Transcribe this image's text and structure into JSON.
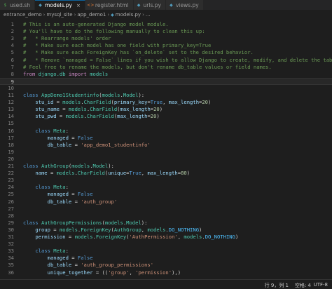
{
  "tabs": [
    {
      "label": "used.sh",
      "icon": "terminal-file-icon",
      "glyph": "$",
      "color": "#4d9e4d",
      "active": false
    },
    {
      "label": "models.py",
      "icon": "python-file-icon",
      "glyph": "◆",
      "color": "#519aba",
      "active": true
    },
    {
      "label": "register.html",
      "icon": "html-file-icon",
      "glyph": "<>",
      "color": "#e37933",
      "active": false
    },
    {
      "label": "urls.py",
      "icon": "python-file-icon",
      "glyph": "◆",
      "color": "#519aba",
      "active": false
    },
    {
      "label": "views.py",
      "icon": "python-file-icon",
      "glyph": "◆",
      "color": "#519aba",
      "active": false
    }
  ],
  "breadcrumb": [
    "entrance_demo",
    "mysql_site",
    "app_demo1",
    "models.py",
    "..."
  ],
  "editor": {
    "current_line": 9,
    "lines": [
      {
        "n": "1",
        "t": [
          [
            "com",
            "# This is an auto-generated Django model module."
          ]
        ]
      },
      {
        "n": "2",
        "t": [
          [
            "com",
            "# You'll have to do the following manually to clean this up:"
          ]
        ]
      },
      {
        "n": "3",
        "t": [
          [
            "com",
            "#   * Rearrange models' order"
          ]
        ]
      },
      {
        "n": "4",
        "t": [
          [
            "com",
            "#   * Make sure each model has one field with primary_key=True"
          ]
        ]
      },
      {
        "n": "5",
        "t": [
          [
            "com",
            "#   * Make sure each ForeignKey has `on_delete` set to the desired behavior."
          ]
        ]
      },
      {
        "n": "6",
        "t": [
          [
            "com",
            "#   * Remove `managed = False` lines if you wish to allow Django to create, modify, and delete the table"
          ]
        ]
      },
      {
        "n": "7",
        "t": [
          [
            "com",
            "# Feel free to rename the models, but don't rename db_table values or field names."
          ]
        ]
      },
      {
        "n": "8",
        "t": [
          [
            "kw2",
            "from "
          ],
          [
            "cls",
            "django.db "
          ],
          [
            "kw2",
            "import "
          ],
          [
            "cls",
            "models"
          ]
        ]
      },
      {
        "n": "9",
        "t": []
      },
      {
        "n": "10",
        "t": []
      },
      {
        "n": "11",
        "t": [
          [
            "kw",
            "class "
          ],
          [
            "cls",
            "AppDemo1Studentinfo"
          ],
          [
            "plain",
            "("
          ],
          [
            "cls",
            "models"
          ],
          [
            "plain",
            "."
          ],
          [
            "cls",
            "Model"
          ],
          [
            "plain",
            "):"
          ]
        ]
      },
      {
        "n": "12",
        "t": [
          [
            "plain",
            "    "
          ],
          [
            "var",
            "stu_id"
          ],
          [
            "plain",
            " = "
          ],
          [
            "cls",
            "models"
          ],
          [
            "plain",
            "."
          ],
          [
            "cls",
            "CharField"
          ],
          [
            "plain",
            "("
          ],
          [
            "var",
            "primary_key"
          ],
          [
            "plain",
            "="
          ],
          [
            "const",
            "True"
          ],
          [
            "plain",
            ", "
          ],
          [
            "var",
            "max_length"
          ],
          [
            "plain",
            "="
          ],
          [
            "num",
            "20"
          ],
          [
            "plain",
            ")"
          ]
        ]
      },
      {
        "n": "13",
        "t": [
          [
            "plain",
            "    "
          ],
          [
            "var",
            "stu_name"
          ],
          [
            "plain",
            " = "
          ],
          [
            "cls",
            "models"
          ],
          [
            "plain",
            "."
          ],
          [
            "cls",
            "CharField"
          ],
          [
            "plain",
            "("
          ],
          [
            "var",
            "max_length"
          ],
          [
            "plain",
            "="
          ],
          [
            "num",
            "20"
          ],
          [
            "plain",
            ")"
          ]
        ]
      },
      {
        "n": "14",
        "t": [
          [
            "plain",
            "    "
          ],
          [
            "var",
            "stu_pwd"
          ],
          [
            "plain",
            " = "
          ],
          [
            "cls",
            "models"
          ],
          [
            "plain",
            "."
          ],
          [
            "cls",
            "CharField"
          ],
          [
            "plain",
            "("
          ],
          [
            "var",
            "max_length"
          ],
          [
            "plain",
            "="
          ],
          [
            "num",
            "20"
          ],
          [
            "plain",
            ")"
          ]
        ]
      },
      {
        "n": "15",
        "t": []
      },
      {
        "n": "16",
        "t": [
          [
            "plain",
            "    "
          ],
          [
            "kw",
            "class "
          ],
          [
            "cls",
            "Meta"
          ],
          [
            "plain",
            ":"
          ]
        ]
      },
      {
        "n": "17",
        "t": [
          [
            "plain",
            "        "
          ],
          [
            "var",
            "managed"
          ],
          [
            "plain",
            " = "
          ],
          [
            "const",
            "False"
          ]
        ]
      },
      {
        "n": "18",
        "t": [
          [
            "plain",
            "        "
          ],
          [
            "var",
            "db_table"
          ],
          [
            "plain",
            " = "
          ],
          [
            "str",
            "'app_demo1_studentinfo'"
          ]
        ]
      },
      {
        "n": "19",
        "t": []
      },
      {
        "n": "20",
        "t": []
      },
      {
        "n": "21",
        "t": [
          [
            "kw",
            "class "
          ],
          [
            "cls",
            "AuthGroup"
          ],
          [
            "plain",
            "("
          ],
          [
            "cls",
            "models"
          ],
          [
            "plain",
            "."
          ],
          [
            "cls",
            "Model"
          ],
          [
            "plain",
            "):"
          ]
        ]
      },
      {
        "n": "22",
        "t": [
          [
            "plain",
            "    "
          ],
          [
            "var",
            "name"
          ],
          [
            "plain",
            " = "
          ],
          [
            "cls",
            "models"
          ],
          [
            "plain",
            "."
          ],
          [
            "cls",
            "CharField"
          ],
          [
            "plain",
            "("
          ],
          [
            "var",
            "unique"
          ],
          [
            "plain",
            "="
          ],
          [
            "const",
            "True"
          ],
          [
            "plain",
            ", "
          ],
          [
            "var",
            "max_length"
          ],
          [
            "plain",
            "="
          ],
          [
            "num",
            "80"
          ],
          [
            "plain",
            ")"
          ]
        ]
      },
      {
        "n": "23",
        "t": []
      },
      {
        "n": "24",
        "t": [
          [
            "plain",
            "    "
          ],
          [
            "kw",
            "class "
          ],
          [
            "cls",
            "Meta"
          ],
          [
            "plain",
            ":"
          ]
        ]
      },
      {
        "n": "25",
        "t": [
          [
            "plain",
            "        "
          ],
          [
            "var",
            "managed"
          ],
          [
            "plain",
            " = "
          ],
          [
            "const",
            "False"
          ]
        ]
      },
      {
        "n": "26",
        "t": [
          [
            "plain",
            "        "
          ],
          [
            "var",
            "db_table"
          ],
          [
            "plain",
            " = "
          ],
          [
            "str",
            "'auth_group'"
          ]
        ]
      },
      {
        "n": "27",
        "t": []
      },
      {
        "n": "28",
        "t": []
      },
      {
        "n": "29",
        "t": [
          [
            "kw",
            "class "
          ],
          [
            "cls",
            "AuthGroupPermissions"
          ],
          [
            "plain",
            "("
          ],
          [
            "cls",
            "models"
          ],
          [
            "plain",
            "."
          ],
          [
            "cls",
            "Model"
          ],
          [
            "plain",
            "):"
          ]
        ]
      },
      {
        "n": "30",
        "t": [
          [
            "plain",
            "    "
          ],
          [
            "var",
            "group"
          ],
          [
            "plain",
            " = "
          ],
          [
            "cls",
            "models"
          ],
          [
            "plain",
            "."
          ],
          [
            "cls",
            "ForeignKey"
          ],
          [
            "plain",
            "("
          ],
          [
            "cls",
            "AuthGroup"
          ],
          [
            "plain",
            ", "
          ],
          [
            "cls",
            "models"
          ],
          [
            "plain",
            "."
          ],
          [
            "blue",
            "DO_NOTHING"
          ],
          [
            "plain",
            ")"
          ]
        ]
      },
      {
        "n": "31",
        "t": [
          [
            "plain",
            "    "
          ],
          [
            "var",
            "permission"
          ],
          [
            "plain",
            " = "
          ],
          [
            "cls",
            "models"
          ],
          [
            "plain",
            "."
          ],
          [
            "cls",
            "ForeignKey"
          ],
          [
            "plain",
            "("
          ],
          [
            "str",
            "'AuthPermission'"
          ],
          [
            "plain",
            ", "
          ],
          [
            "cls",
            "models"
          ],
          [
            "plain",
            "."
          ],
          [
            "blue",
            "DO_NOTHING"
          ],
          [
            "plain",
            ")"
          ]
        ]
      },
      {
        "n": "32",
        "t": []
      },
      {
        "n": "33",
        "t": [
          [
            "plain",
            "    "
          ],
          [
            "kw",
            "class "
          ],
          [
            "cls",
            "Meta"
          ],
          [
            "plain",
            ":"
          ]
        ]
      },
      {
        "n": "34",
        "t": [
          [
            "plain",
            "        "
          ],
          [
            "var",
            "managed"
          ],
          [
            "plain",
            " = "
          ],
          [
            "const",
            "False"
          ]
        ]
      },
      {
        "n": "35",
        "t": [
          [
            "plain",
            "        "
          ],
          [
            "var",
            "db_table"
          ],
          [
            "plain",
            " = "
          ],
          [
            "str",
            "'auth_group_permissions'"
          ]
        ]
      },
      {
        "n": "36",
        "t": [
          [
            "plain",
            "        "
          ],
          [
            "var",
            "unique_together"
          ],
          [
            "plain",
            " = (("
          ],
          [
            "str",
            "'group'"
          ],
          [
            "plain",
            ", "
          ],
          [
            "str",
            "'permission'"
          ],
          [
            "plain",
            "),)"
          ]
        ]
      }
    ]
  },
  "status": {
    "position": "行 9，列 1",
    "spaces": "空格: 4",
    "encoding": "UTF-8"
  }
}
